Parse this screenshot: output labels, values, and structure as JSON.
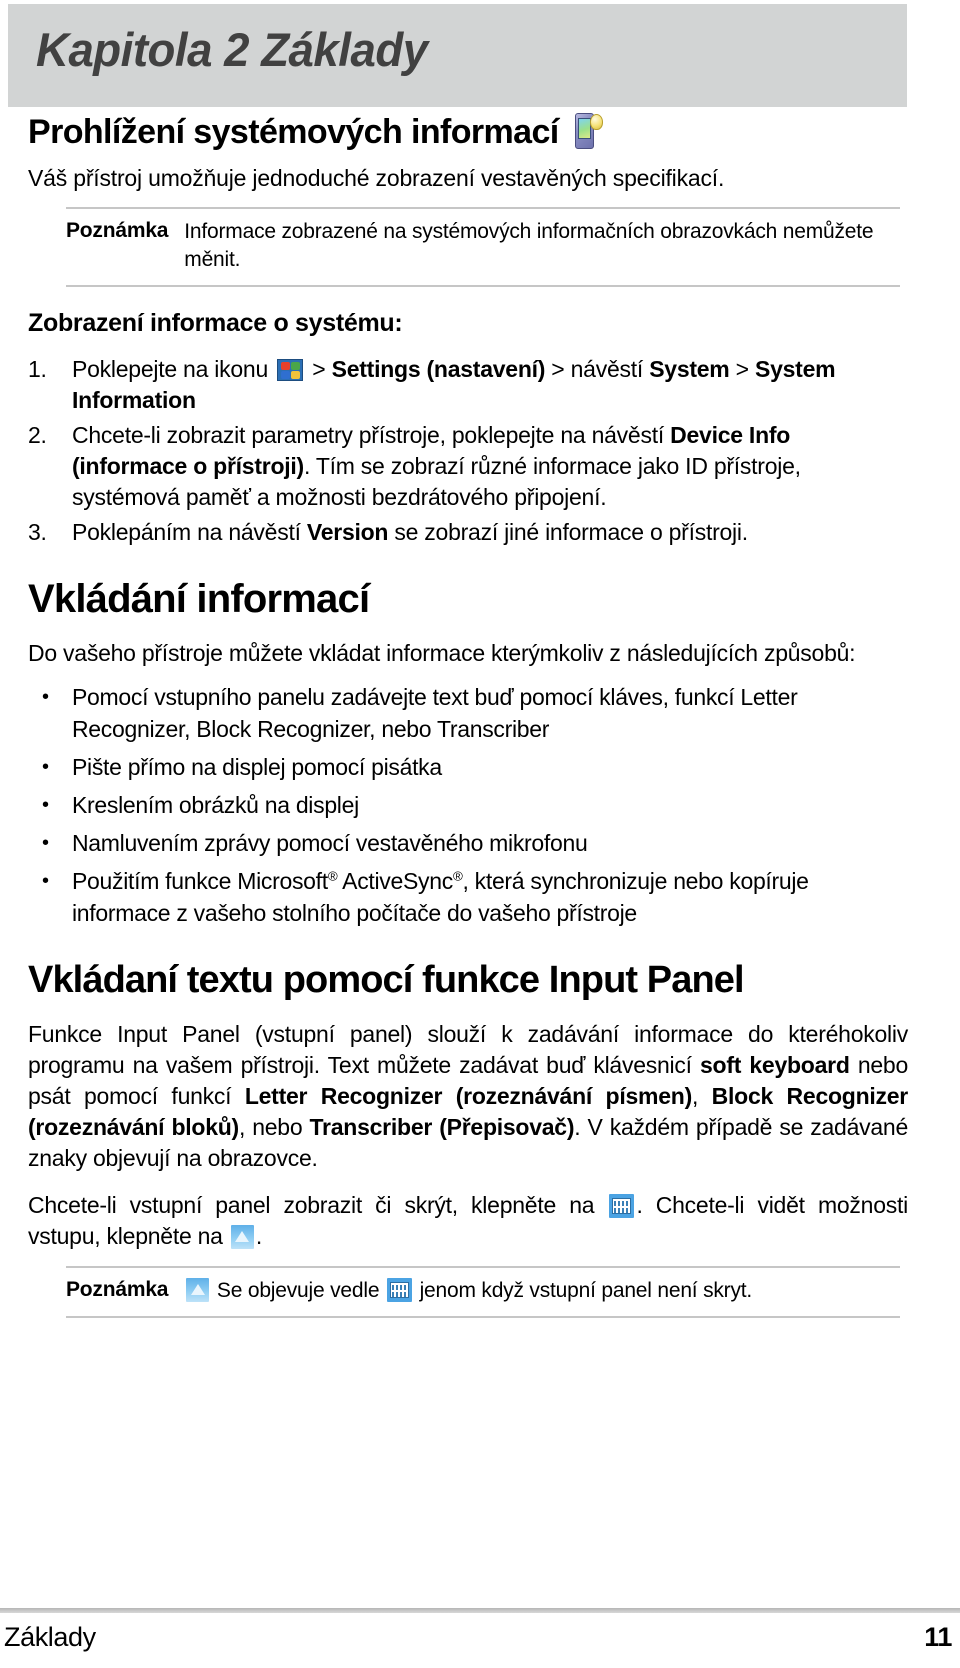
{
  "chapter": {
    "title": "Kapitola 2 Základy",
    "band_color": "#d2d4d4",
    "title_color": "#414141"
  },
  "section": {
    "title": "Prohlížení systémových informací",
    "icon": "pocket-pc-device-icon",
    "lead": "Váš přístroj umožňuje jednoduché zobrazení vestavěných specifikací."
  },
  "note_top": {
    "label": "Poznámka",
    "text": "Informace zobrazené na systémových informačních obrazovkách nemůžete měnit."
  },
  "subsection": {
    "title": "Zobrazení informace o systému:"
  },
  "steps": [
    {
      "num": "1.",
      "parts": [
        {
          "t": "Poklepejte na ikonu ",
          "b": false
        },
        {
          "t": "start-menu-icon",
          "icon": true
        },
        {
          "t": " > ",
          "b": false
        },
        {
          "t": "Settings (nastavení)",
          "b": true
        },
        {
          "t": " > návěstí ",
          "b": false
        },
        {
          "t": "System",
          "b": true
        },
        {
          "t": " > ",
          "b": false
        },
        {
          "t": "System Information",
          "b": true
        }
      ]
    },
    {
      "num": "2.",
      "parts": [
        {
          "t": "Chcete-li zobrazit parametry přístroje, poklepejte na návěstí ",
          "b": false
        },
        {
          "t": "Device Info (informace o přístroji)",
          "b": true
        },
        {
          "t": ". Tím se zobrazí různé informace jako ID přístroje, systémová paměť a možnosti bezdrátového připojení.",
          "b": false
        }
      ]
    },
    {
      "num": "3.",
      "parts": [
        {
          "t": "Poklepáním na návěstí ",
          "b": false
        },
        {
          "t": "Version",
          "b": true
        },
        {
          "t": " se zobrazí jiné informace o přístroji.",
          "b": false
        }
      ]
    }
  ],
  "heading_vkladani": "Vkládání informací",
  "intro_vkladani": "Do vašeho přístroje můžete vkládat informace kterýmkoliv z následujících způsobů:",
  "bullets": [
    "Pomocí vstupního panelu zadávejte text buď pomocí kláves, funkcí Letter Recognizer, Block Recognizer, nebo Transcriber",
    "Pište přímo na displej pomocí pisátka",
    "Kreslením obrázků na displej",
    "Namluvením zprávy pomocí vestavěného mikrofonu",
    "ACTIVESYNC_BULLET"
  ],
  "bullet_activesync": {
    "p1": "Použitím funkce Microsoft",
    "reg1": "®",
    "p2": " ActiveSync",
    "reg2": "®",
    "p3": ", která synchronizuje nebo kopíruje informace z vašeho stolního počítače do vašeho přístroje"
  },
  "heading_input_panel": "Vkládaní textu pomocí funkce Input Panel",
  "input_panel_paragraph": {
    "p1": "Funkce Input Panel (vstupní panel) slouží k zadávání informace do kteréhokoliv programu na vašem přístroji. Text můžete zadávat buď klávesnicí ",
    "b1": "soft keyboard",
    "p2": " nebo psát pomocí funkcí ",
    "b2": "Letter Recognizer (rozeznávání písmen)",
    "p3": ", ",
    "b3": "Block Recognizer (rozeznávání bloků)",
    "p4": ", nebo ",
    "b4": "Transcriber (Přepisovač)",
    "p5": ". V každém případě se zadávané znaky objevují na obrazovce."
  },
  "show_hide_paragraph": {
    "p1": "Chcete-li vstupní panel zobrazit či skrýt, klepněte na ",
    "icon1": "keyboard-icon",
    "p2": ". Chcete-li vidět možnosti vstupu, klepněte na ",
    "icon2": "up-arrow-icon",
    "p3": "."
  },
  "note_bottom": {
    "label": "Poznámka",
    "icon1": "up-arrow-icon",
    "p1": " Se objevuje vedle ",
    "icon2": "keyboard-icon",
    "p2": " jenom když vstupní panel není skryt."
  },
  "footer": {
    "left": "Základy",
    "page": "11"
  }
}
